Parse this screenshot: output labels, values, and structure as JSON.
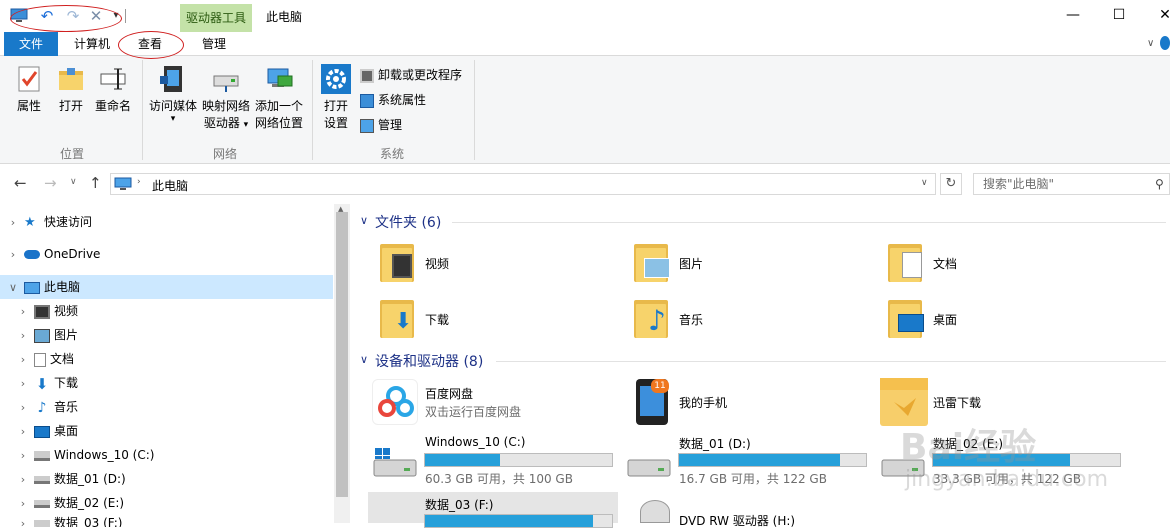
{
  "window": {
    "title": "此电脑",
    "contextual_tab": "驱动器工具",
    "controls": {
      "minimize": "—",
      "maximize": "☐",
      "close": "✕"
    }
  },
  "tabs": {
    "file": "文件",
    "computer": "计算机",
    "view": "查看",
    "manage": "管理"
  },
  "ribbon": {
    "location": {
      "properties": "属性",
      "open": "打开",
      "rename": "重命名",
      "label": "位置"
    },
    "network": {
      "access_media": "访问媒体",
      "map_drive_1": "映射网络",
      "map_drive_2": "驱动器",
      "add_location_1": "添加一个",
      "add_location_2": "网络位置",
      "label": "网络"
    },
    "system": {
      "open_settings_1": "打开",
      "open_settings_2": "设置",
      "uninstall": "卸载或更改程序",
      "sys_props": "系统属性",
      "manage": "管理",
      "label": "系统"
    }
  },
  "address": {
    "path": "此电脑",
    "search_placeholder": "搜索\"此电脑\""
  },
  "nav": {
    "quick_access": "快速访问",
    "onedrive": "OneDrive",
    "this_pc": "此电脑",
    "videos": "视频",
    "pictures": "图片",
    "documents": "文档",
    "downloads": "下载",
    "music": "音乐",
    "desktop": "桌面",
    "drive_c": "Windows_10 (C:)",
    "drive_d": "数据_01 (D:)",
    "drive_e": "数据_02 (E:)",
    "drive_f": "数据_03 (F:)"
  },
  "folders": {
    "heading": "文件夹 (6)",
    "items": [
      "视频",
      "图片",
      "文档",
      "下载",
      "音乐",
      "桌面"
    ]
  },
  "devices": {
    "heading": "设备和驱动器 (8)",
    "baidu": {
      "name": "百度网盘",
      "sub": "双击运行百度网盘"
    },
    "phone": {
      "name": "我的手机",
      "badge": "11"
    },
    "thunder": {
      "name": "迅雷下载"
    },
    "drive_c": {
      "name": "Windows_10 (C:)",
      "free": "60.3 GB 可用，共 100 GB",
      "used_fraction": 0.4
    },
    "drive_d": {
      "name": "数据_01 (D:)",
      "free": "16.7 GB 可用，共 122 GB",
      "used_fraction": 0.86
    },
    "drive_e": {
      "name": "数据_02 (E:)",
      "free": "33.3 GB 可用，共 122 GB",
      "used_fraction": 0.73
    },
    "drive_f": {
      "name": "数据_03 (F:)",
      "used_fraction": 0.9
    },
    "dvd": {
      "name": "DVD RW 驱动器 (H:)"
    }
  },
  "watermark": {
    "text": "Bai经验",
    "url": "jingyan.baidu.com"
  },
  "colors": {
    "accent": "#1979ca",
    "bar_fill": "#26a0da",
    "annotation": "#d02020"
  }
}
